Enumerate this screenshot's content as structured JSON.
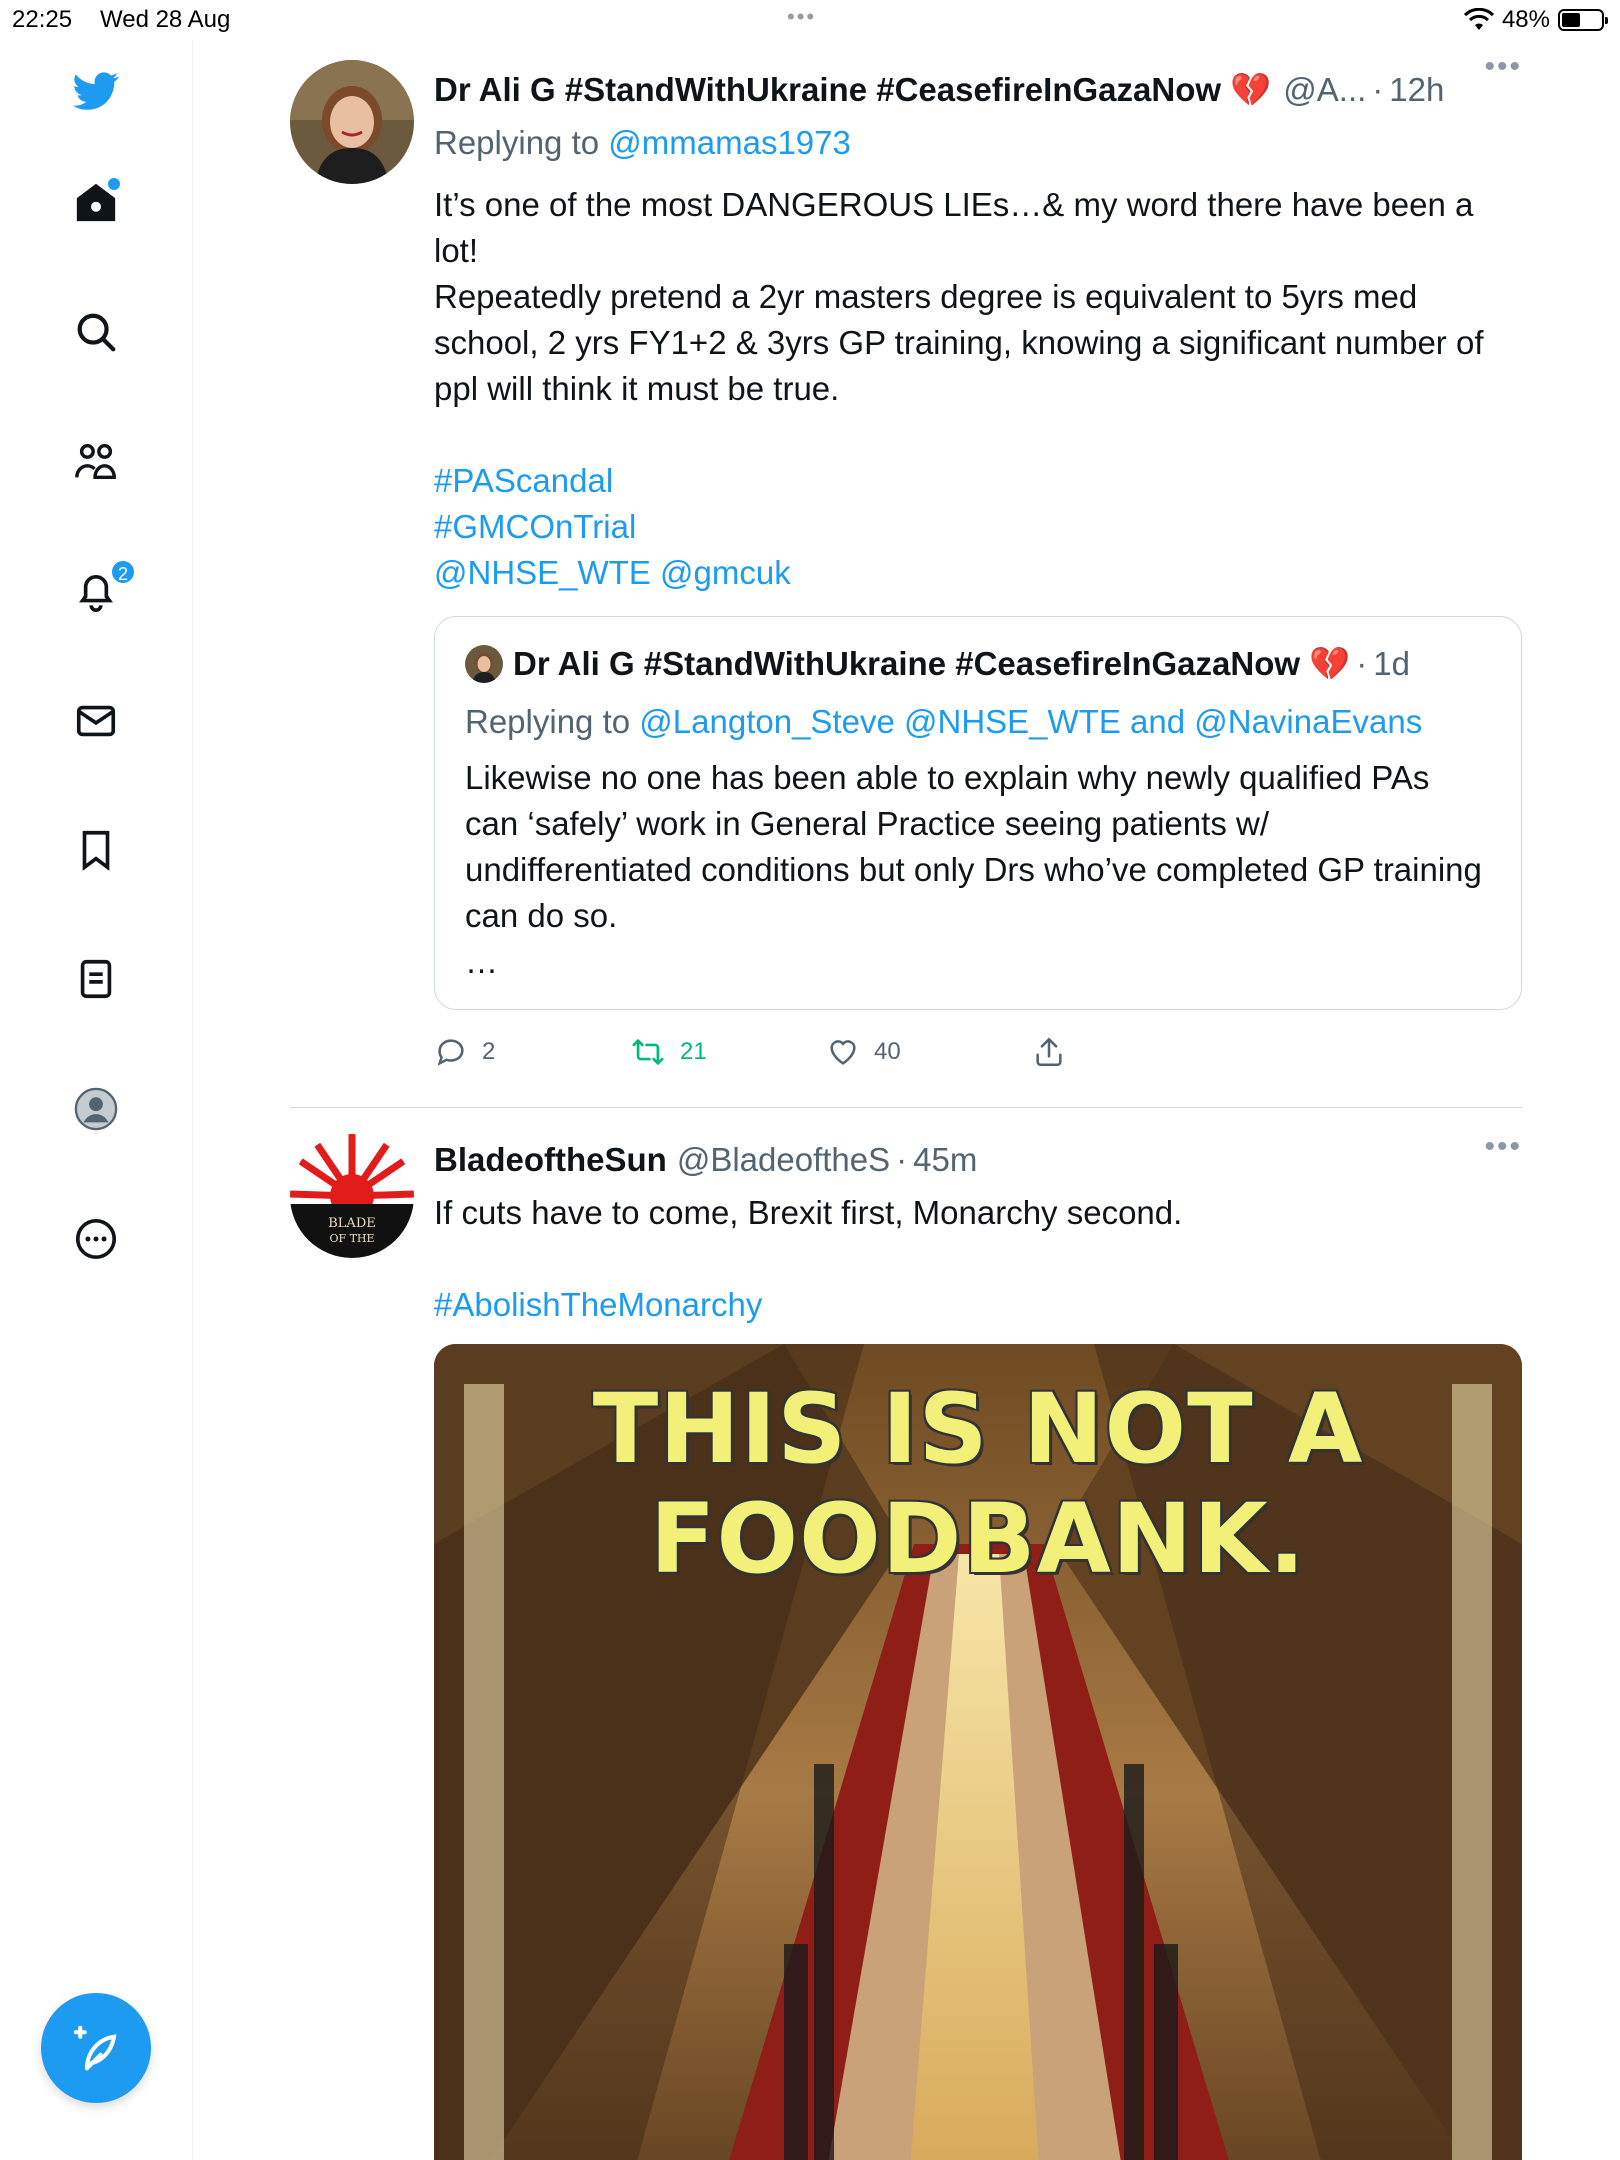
{
  "status_bar": {
    "time": "22:25",
    "date": "Wed 28 Aug",
    "battery": "48%",
    "battery_level": 0.48
  },
  "sidebar": {
    "notifications_badge": "2"
  },
  "tweets": [
    {
      "author": "Dr Ali G #StandWithUkraine #CeasefireInGazaNow 💔",
      "handle": "@A...",
      "time": "12h",
      "replying_label": "Replying to",
      "replying_to": "@mmamas1973",
      "text_line1": "It’s one of the most DANGEROUS LIEs…& my word there have been a lot!",
      "text_line2": "Repeatedly pretend a 2yr masters degree is equivalent to 5yrs med school, 2 yrs FY1+2 & 3yrs GP training, knowing a significant number of ppl will think it must be true.",
      "hashtag1": "#PAScandal",
      "hashtag2": "#GMCOnTrial",
      "mention1": "@NHSE_WTE",
      "mention2": "@gmcuk",
      "quote": {
        "author": "Dr Ali G #StandWithUkraine #CeasefireInGazaNow 💔",
        "time": "1d",
        "replying_label": "Replying to",
        "replying_to1": "@Langton_Steve",
        "replying_to2": "@NHSE_WTE",
        "and": "and",
        "replying_to3": "@NavinaEvans",
        "text": "Likewise no one has been able to explain why newly qualified PAs can ‘safely’ work in General Practice seeing patients w/ undifferentiated conditions but only Drs who’ve completed GP training can do so.",
        "ellipsis": "…"
      },
      "replies": "2",
      "retweets": "21",
      "likes": "40"
    },
    {
      "author": "BladeoftheSun",
      "handle": "@BladeoftheS",
      "time": "45m",
      "text": "If cuts have to come, Brexit first, Monarchy second.",
      "hashtag": "#AbolishTheMonarchy",
      "avatar_text": "BLADE OF THE",
      "image_caption_line1": "THIS IS NOT A",
      "image_caption_line2": "FOODBANK."
    }
  ],
  "colors": {
    "accent": "#1d9bf0",
    "retweet": "#00ba7c",
    "heart": "#e0245e",
    "muted": "#536471"
  }
}
